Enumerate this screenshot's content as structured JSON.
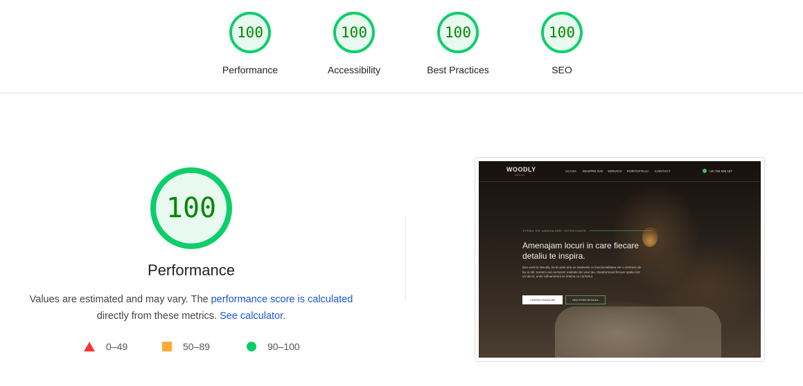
{
  "summary": [
    {
      "score": "100",
      "label": "Performance"
    },
    {
      "score": "100",
      "label": "Accessibility"
    },
    {
      "score": "100",
      "label": "Best Practices"
    },
    {
      "score": "100",
      "label": "SEO"
    }
  ],
  "main": {
    "score": "100",
    "title": "Performance",
    "desc_1": "Values are estimated and may vary. The ",
    "link_score": "performance score is calculated",
    "desc_2": " directly from these metrics. ",
    "link_calc": "See calculator",
    "desc_3": "."
  },
  "legend": {
    "fail": "0–49",
    "average": "50–89",
    "pass": "90–100"
  },
  "colors": {
    "pass_ring": "#0cce6b",
    "pass_fill": "#e8faf0",
    "pass_text": "#008800",
    "fail": "#ff3333",
    "average": "#ffaa33",
    "pass_dot": "#00cc66",
    "link": "#1a56db"
  },
  "screenshot": {
    "logo": "WOODLY",
    "logo_sub": "DESIGN",
    "menu": [
      "ACASA",
      "DESPRE NOI",
      "SERVICII",
      "PORTOFOLIU",
      "CONTACT"
    ],
    "phone": "+40 755 636 187",
    "eyebrow": "FIRMA DE AMENAJARI INTERIOARE",
    "headline": "Amenajam locuri in care fiecare detaliu te inspira.",
    "paragraph": "Bun venit la Woodly, locul unde arta se intalneste cu functionalitatea intr-o simfonie de lux si stil. Suntem aici sa facem realitate din visul tau, transformand fiecare spatiu intr-un decor, unde rafinamentul se imbina cu confortul.",
    "cta_primary": "CONTACTEAZA-NE",
    "cta_secondary": "VEZI PORTOFOLIUL"
  }
}
